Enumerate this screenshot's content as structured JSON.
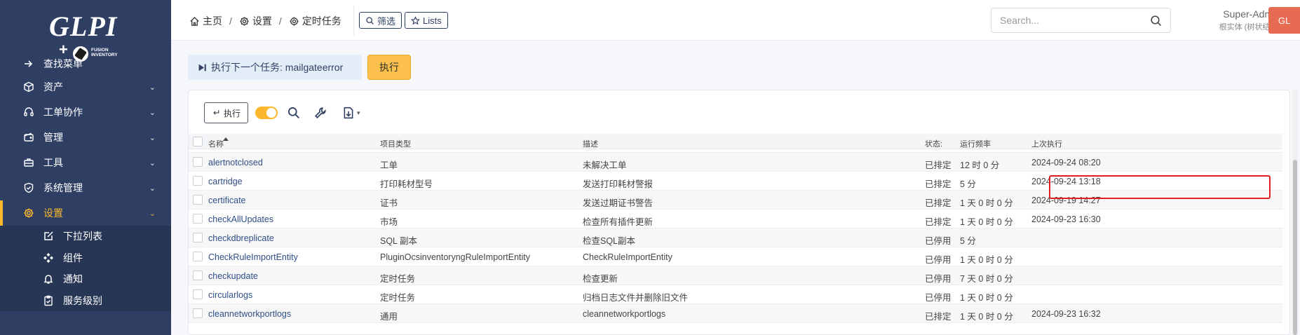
{
  "sidebar": {
    "logo": {
      "text": "GLPI",
      "sub": "FUSION INVENTORY"
    },
    "items": [
      {
        "label": "查找菜单",
        "icon": "arrow-right-icon",
        "chev": false
      },
      {
        "label": "资产",
        "icon": "box-icon",
        "chev": true
      },
      {
        "label": "工单协作",
        "icon": "headset-icon",
        "chev": true
      },
      {
        "label": "管理",
        "icon": "wallet-icon",
        "chev": true
      },
      {
        "label": "工具",
        "icon": "briefcase-icon",
        "chev": true
      },
      {
        "label": "系统管理",
        "icon": "shield-check-icon",
        "chev": true
      },
      {
        "label": "设置",
        "icon": "gear-icon",
        "chev": true,
        "active": true
      }
    ],
    "subitems": [
      {
        "label": "下拉列表",
        "icon": "edit-icon"
      },
      {
        "label": "组件",
        "icon": "components-icon"
      },
      {
        "label": "通知",
        "icon": "bell-icon"
      },
      {
        "label": "服务级别",
        "icon": "clipboard-check-icon"
      }
    ]
  },
  "header": {
    "breadcrumbs": [
      "主页",
      "设置",
      "定时任务"
    ],
    "filter_label": "筛选",
    "lists_label": "Lists",
    "search_placeholder": "Search...",
    "user_name": "Super-Admin",
    "user_entity": "根实体 (树状结构)",
    "avatar_initials": "GL"
  },
  "next_task": {
    "label": "执行下一个任务: mailgateerror",
    "exec_label": "执行"
  },
  "toolbar": {
    "exec_label": "执行"
  },
  "table": {
    "columns": [
      "名称",
      "项目类型",
      "描述",
      "状态:",
      "运行频率",
      "上次执行"
    ],
    "rows": [
      {
        "name": "alertnotclosed",
        "type": "工单",
        "desc": "未解决工单",
        "status": "已排定",
        "freq": "12 时 0 分",
        "last": "2024-09-24 08:20"
      },
      {
        "name": "cartridge",
        "type": "打印耗材型号",
        "desc": "发送打印耗材警报",
        "status": "已排定",
        "freq": "5 分",
        "last": "2024-09-24 13:18"
      },
      {
        "name": "certificate",
        "type": "证书",
        "desc": "发送过期证书警告",
        "status": "已排定",
        "freq": "1 天 0 时 0 分",
        "last": "2024-09-19 14:27"
      },
      {
        "name": "checkAllUpdates",
        "type": "市场",
        "desc": "检查所有插件更新",
        "status": "已排定",
        "freq": "1 天 0 时 0 分",
        "last": "2024-09-23 16:30"
      },
      {
        "name": "checkdbreplicate",
        "type": "SQL 副本",
        "desc": "检查SQL副本",
        "status": "已停用",
        "freq": "5 分",
        "last": ""
      },
      {
        "name": "CheckRuleImportEntity",
        "type": "PluginOcsinventoryngRuleImportEntity",
        "desc": "CheckRuleImportEntity",
        "status": "已停用",
        "freq": "1 天 0 时 0 分",
        "last": ""
      },
      {
        "name": "checkupdate",
        "type": "定时任务",
        "desc": "检查更新",
        "status": "已停用",
        "freq": "7 天 0 时 0 分",
        "last": ""
      },
      {
        "name": "circularlogs",
        "type": "定时任务",
        "desc": "归档日志文件并删除旧文件",
        "status": "已停用",
        "freq": "1 天 0 时 0 分",
        "last": ""
      },
      {
        "name": "cleannetworkportlogs",
        "type": "通用",
        "desc": "cleannetworkportlogs",
        "status": "已排定",
        "freq": "1 天 0 时 0 分",
        "last": "2024-09-23 16:32"
      }
    ]
  },
  "colors": {
    "sidebar_bg": "#2f3f64",
    "accent": "#fcb72c",
    "highlight": "#e02020",
    "avatar": "#e76b52"
  }
}
